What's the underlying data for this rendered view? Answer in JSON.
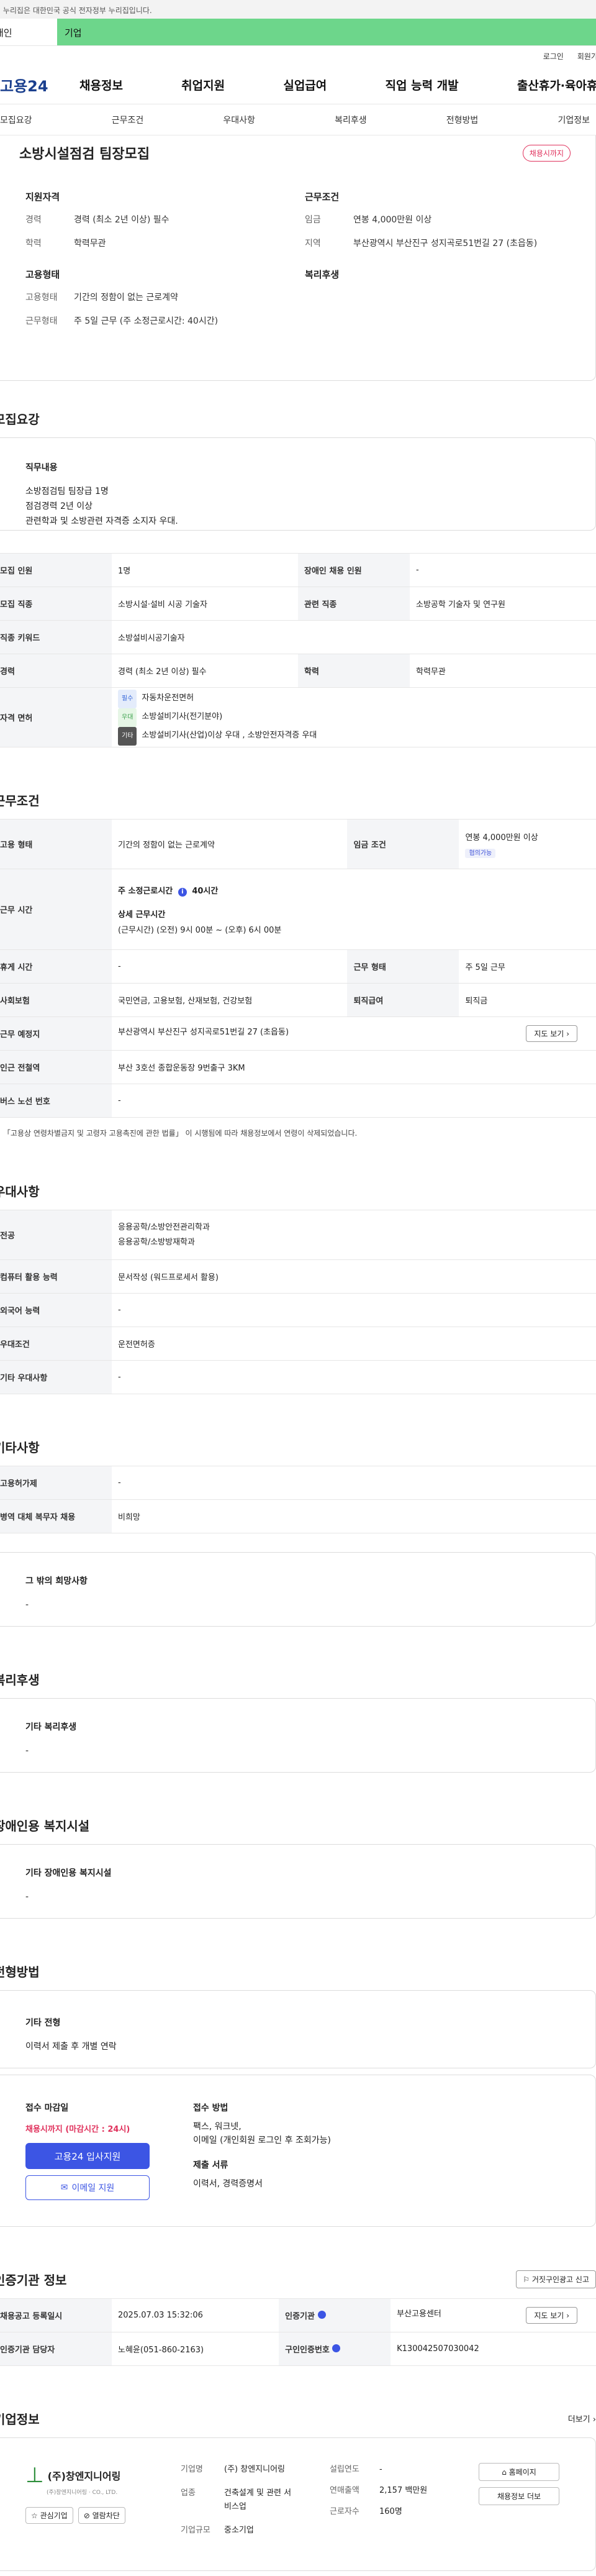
{
  "gov_notice": "이 누리집은 대한민국 공식 전자정부 누리집입니다.",
  "top_tabs": {
    "personal": "개인",
    "company": "기업"
  },
  "util": {
    "login": "로그인",
    "signup": "회원가입"
  },
  "logo": "고용24",
  "gnb": [
    "채용정보",
    "취업지원",
    "실업급여",
    "직업 능력 개발",
    "출산휴가·육아휴직"
  ],
  "anchors": [
    "모집요강",
    "근무조건",
    "우대사항",
    "복리후생",
    "전형방법",
    "기업정보"
  ],
  "job": {
    "title": "소방시설점검 팀장모집",
    "status_badge": "채용시까지"
  },
  "summary": {
    "qual_title": "지원자격",
    "career_k": "경력",
    "career_v": "경력 (최소 2년 이상) 필수",
    "edu_k": "학력",
    "edu_v": "학력무관",
    "cond_title": "근무조건",
    "wage_k": "임금",
    "wage_v": "연봉 4,000만원 이상",
    "loc_k": "지역",
    "loc_v": "부산광역시 부산진구 성지곡로51번길 27 (초읍동)",
    "emp_title": "고용형태",
    "type_k": "고용형태",
    "type_v": "기간의 정함이 없는 근로계약",
    "work_k": "근무형태",
    "work_v": "주 5일 근무 (주 소정근로시간: 40시간)",
    "welfare_title": "복리후생"
  },
  "recruit": {
    "section_title": "모집요강",
    "duty_label": "직무내용",
    "duty_lines": [
      "소방점검팀 팀장급 1명",
      "점검경력 2년 이상",
      "관련학과 및 소방관련 자격증 소지자 우대."
    ],
    "rows": {
      "count_k": "모집 인원",
      "count_v": "1명",
      "pre_k": "장애인 채용 인원",
      "pre_v": "-",
      "job_k": "모집 직종",
      "job_v": "소방시설·설비 시공 기술자",
      "rel_k": "관련 직종",
      "rel_v": "소방공학 기술자 및 연구원",
      "kw_k": "직종 키워드",
      "kw_v": "소방설비시공기술자",
      "career_k": "경력",
      "career_v": "경력 (최소 2년 이상) 필수",
      "edu_k": "학력",
      "edu_v": "학력무관",
      "lic_k": "자격 면허",
      "lic": [
        {
          "tag": "필수",
          "text": "자동차운전면허"
        },
        {
          "tag": "우대",
          "text": "소방설비기사(전기분야)"
        },
        {
          "tag": "기타",
          "text": "소방설비기사(산업)이상 우대 , 소방안전자격증 우대"
        }
      ]
    }
  },
  "conditions": {
    "section_title": "근무조건",
    "type_k": "고용 형태",
    "type_v": "기간의 정함이 없는 근로계약",
    "wage_k": "임금 조건",
    "wage_v": "연봉 4,000만원 이상",
    "wage_chip": "협의가능",
    "hours_k": "근무 시간",
    "hours_main": "주 소정근로시간",
    "hours_info": "i",
    "hours_val": "40시간",
    "hours_detail_label": "상세 근무시간",
    "hours_detail": "(근무시간) (오전) 9시 00분 ~ (오후) 6시 00분",
    "break_k": "휴게 시간",
    "break_v": "-",
    "form_k": "근무 형태",
    "form_v": "주 5일 근무",
    "ins_k": "사회보험",
    "ins_v": "국민연금, 고용보험, 산재보험, 건강보험",
    "ret_k": "퇴직급여",
    "ret_v": "퇴직금",
    "place_k": "근무 예정지",
    "place_v": "부산광역시 부산진구 성지곡로51번길 27 (초읍동)",
    "map_btn": "지도 보기",
    "subway_k": "인근 전철역",
    "subway_v": "부산 3호선 종합운동장 9번출구 3KM",
    "bus_k": "버스 노선 번호",
    "bus_v": "-",
    "note": "「고용상 연령차별금지 및 고령자 고용촉진에 관한 법률」 이 시행됨에 따라 채용정보에서 연령이 삭제되었습니다."
  },
  "pref": {
    "section_title": "우대사항",
    "major_k": "전공",
    "major_v": [
      "응용공학/소방안전관리학과",
      "응용공학/소방방재학과"
    ],
    "pc_k": "컴퓨터 활용 능력",
    "pc_v": "문서작성 (워드프로세서 활용)",
    "lang_k": "외국어 능력",
    "lang_v": "-",
    "cond_k": "우대조건",
    "cond_v": "운전면허증",
    "etc_k": "기타 우대사항",
    "etc_v": "-"
  },
  "other": {
    "section_title": "기타사항",
    "emp_k": "고용허가제",
    "emp_v": "-",
    "mil_k": "병역 대체 복무자 채용",
    "mil_v": "비희망",
    "wish_label": "그 밖의 희망사항",
    "wish_v": "-"
  },
  "welfare": {
    "section_title": "복리후생",
    "label": "기타 복리후생",
    "value": "-"
  },
  "disability": {
    "section_title": "장애인용 복지시설",
    "label": "기타 장애인용 복지시설",
    "value": "-"
  },
  "selection": {
    "section_title": "전형방법",
    "label": "기타 전형",
    "value": "이력서 제출 후 개별 연락",
    "deadline_label": "접수 마감일",
    "deadline_value": "채용시까지 (마감시간 : 24시)",
    "apply_btn": "고용24 입사지원",
    "email_btn": "이메일 지원",
    "method_label": "접수 방법",
    "method_value": [
      "팩스, 워크넷,",
      "이메일 (개인회원 로그인 후 조회가능)"
    ],
    "docs_label": "제출 서류",
    "docs_value": "이력서, 경력증명서"
  },
  "cert": {
    "section_title": "인증기관 정보",
    "report_btn": "거짓구인광고 신고",
    "reg_k": "채용공고 등록일시",
    "reg_v": "2025.07.03 15:32:06",
    "org_k": "인증기관",
    "org_v": "부산고용센터",
    "map_btn": "지도 보기",
    "mgr_k": "인증기관 담당자",
    "mgr_v": "노혜윤(051-860-2163)",
    "no_k": "구인인증번호",
    "no_v": "K130042507030042"
  },
  "company": {
    "section_title": "기업정보",
    "more": "더보기",
    "logo_text": "(주)창엔지니어링",
    "logo_sub": "(주)창엔지니어링 · CO., LTD.",
    "fav_btn": "관심기업",
    "block_btn": "열람차단",
    "name_k": "기업명",
    "name_v": "(주) 창엔지니어링",
    "biz_k": "업종",
    "biz_v": "건축설계 및 관련 서비스업",
    "size_k": "기업규모",
    "size_v": "중소기업",
    "year_k": "설립연도",
    "year_v": "-",
    "sales_k": "연매출액",
    "sales_v": "2,157 백만원",
    "emp_k": "근로자수",
    "emp_v": "160명",
    "home_btn": "홈페이지",
    "list_btn": "채용정보 더보"
  },
  "colors": {
    "accent_blue": "#3c55e4",
    "badge_pink": "#e0315c",
    "company_green": "#6dd68b"
  }
}
